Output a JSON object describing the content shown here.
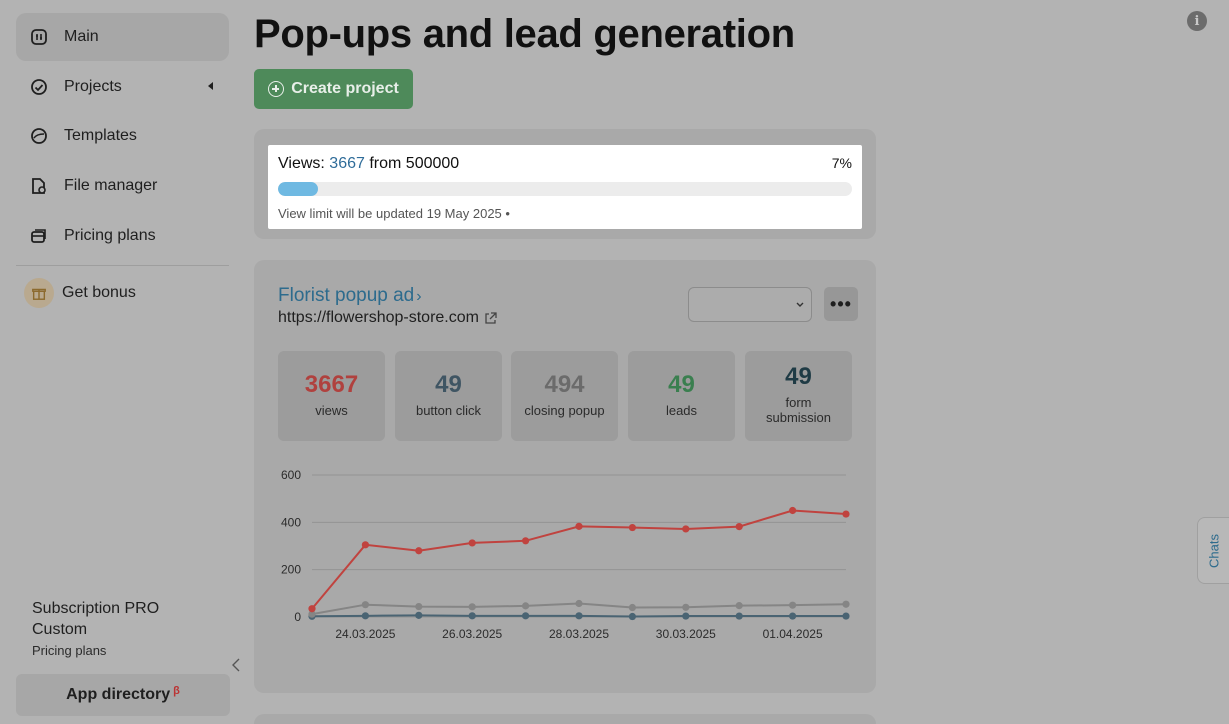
{
  "sidebar": {
    "items": [
      {
        "label": "Main",
        "icon": "main-icon",
        "active": true
      },
      {
        "label": "Projects",
        "icon": "projects-icon",
        "active": false
      },
      {
        "label": "Templates",
        "icon": "templates-icon",
        "active": false
      },
      {
        "label": "File manager",
        "icon": "file-manager-icon",
        "active": false
      },
      {
        "label": "Pricing plans",
        "icon": "pricing-icon",
        "active": false
      }
    ],
    "bonus": {
      "label": "Get bonus",
      "icon": "gift-icon"
    },
    "subscription": {
      "title": "Subscription PRO Custom",
      "link": "Pricing plans"
    },
    "app_directory": {
      "label": "App directory",
      "badge": "β"
    }
  },
  "main": {
    "title": "Pop-ups and lead generation",
    "create_label": "Create project",
    "views": {
      "prefix": "Views:",
      "current": "3667",
      "suffix": "from 500000",
      "percent_label": "7%",
      "progress": 7,
      "note": "View limit will be updated 19 May 2025 •"
    },
    "project": {
      "name": "Florist popup ad",
      "url": "https://flowershop-store.com",
      "more_label": "•••",
      "stats": [
        {
          "value": "3667",
          "label": "views",
          "color": "#b0413e"
        },
        {
          "value": "49",
          "label": "button click",
          "color": "#3f5563"
        },
        {
          "value": "494",
          "label": "closing popup",
          "color": "#6b6b6b"
        },
        {
          "value": "49",
          "label": "leads",
          "color": "#3a7f4f"
        },
        {
          "value": "49",
          "label": "form submission",
          "color": "#1f3b45"
        }
      ]
    }
  },
  "chats_label": "Chats",
  "info_label": "i",
  "chart_data": {
    "type": "line",
    "x": [
      "23.03.2025",
      "24.03.2025",
      "25.03.2025",
      "26.03.2025",
      "27.03.2025",
      "28.03.2025",
      "29.03.2025",
      "30.03.2025",
      "31.03.2025",
      "01.04.2025",
      "02.04.2025"
    ],
    "x_tick_labels": [
      "24.03.2025",
      "26.03.2025",
      "28.03.2025",
      "30.03.2025",
      "01.04.2025"
    ],
    "y_ticks": [
      0,
      200,
      400,
      600
    ],
    "ylim": [
      0,
      600
    ],
    "grid": true,
    "series": [
      {
        "color": "#c0433f",
        "values": [
          35,
          305,
          280,
          313,
          322,
          383,
          378,
          372,
          382,
          450,
          435
        ]
      },
      {
        "color": "#858585",
        "values": [
          12,
          52,
          44,
          43,
          47,
          57,
          40,
          41,
          48,
          50,
          54
        ]
      },
      {
        "color": "#4a6473",
        "values": [
          3,
          5,
          7,
          5,
          5,
          5,
          2,
          4,
          4,
          4,
          4
        ]
      }
    ]
  }
}
